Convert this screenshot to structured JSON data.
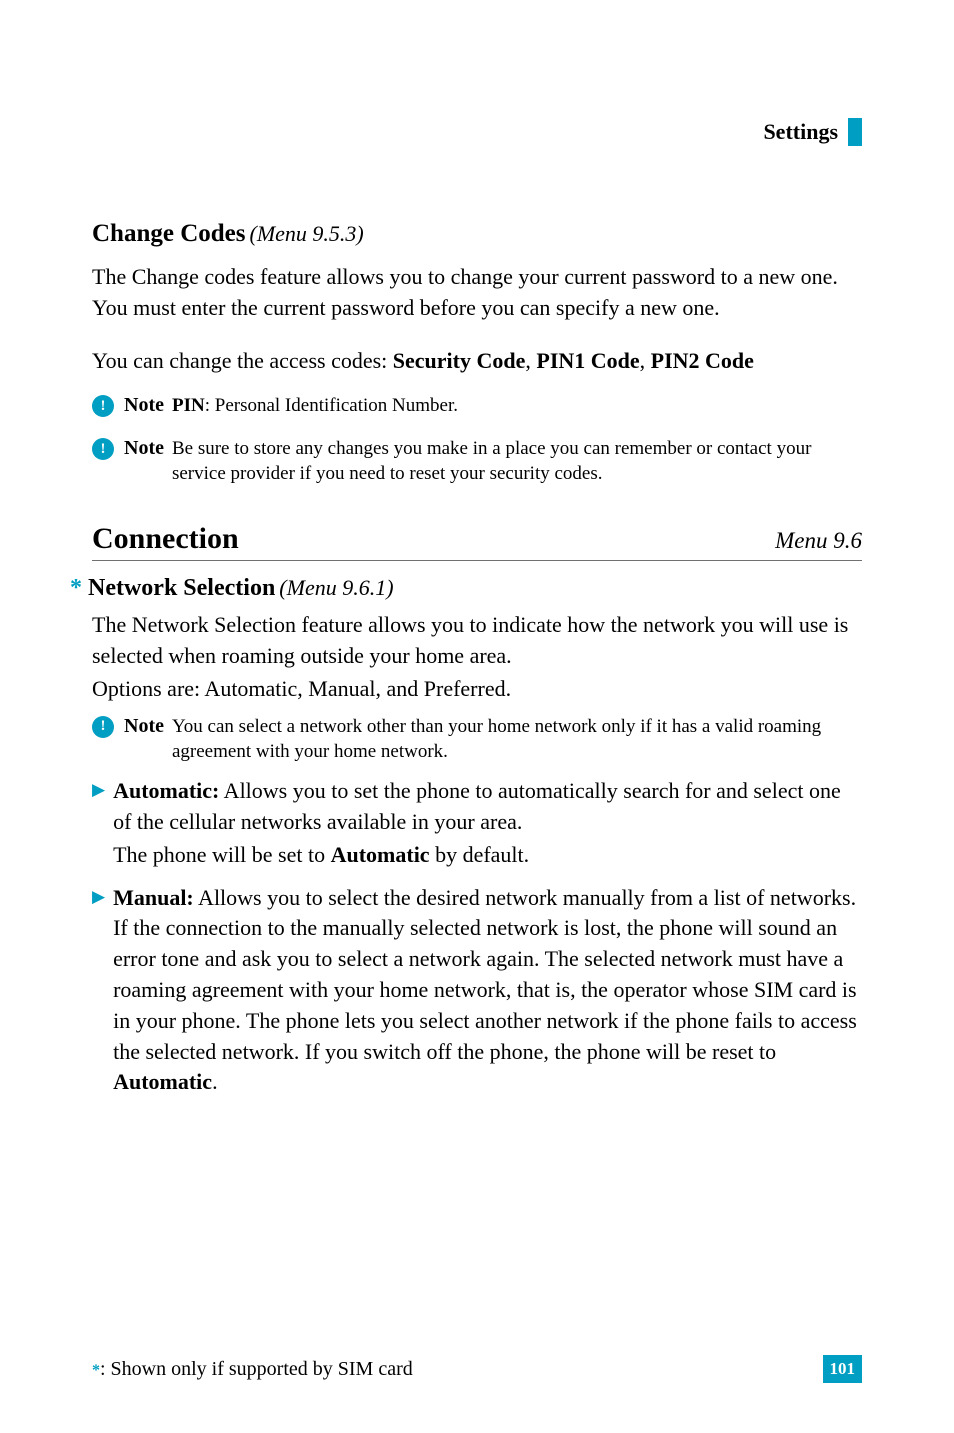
{
  "header": {
    "title": "Settings"
  },
  "changeCodes": {
    "title": "Change Codes",
    "menuRef": "(Menu 9.5.3)",
    "para1": "The Change codes feature allows you to change your current password to a new one. You must enter the current password before you can specify a new one.",
    "para2_pre": "You can change the access codes: ",
    "code1": "Security Code",
    "code2": "PIN1 Code",
    "code3": "PIN2 Code",
    "note1_label": "Note",
    "note1_bold": "PIN",
    "note1_text": ": Personal Identification Number.",
    "note2_label": "Note",
    "note2_text": "Be sure to store any changes you make in a place you can remember or contact your service provider if you need to reset your security codes."
  },
  "connection": {
    "title": "Connection",
    "menuRef": "Menu 9.6"
  },
  "networkSelection": {
    "title": "Network Selection",
    "menuRef": "(Menu 9.6.1)",
    "para1": "The Network Selection feature allows you to indicate how the network you will use is selected when roaming outside your home area.",
    "para2": "Options are: Automatic, Manual, and Preferred.",
    "note_label": "Note",
    "note_text": "You can select a network other than your home network only if it has a valid roaming agreement with your home network.",
    "automatic_label": "Automatic:",
    "automatic_text1": " Allows you to set the phone to automatically search for and select one of the cellular networks available in your area.",
    "automatic_text2_pre": "The phone will be set to ",
    "automatic_text2_bold": "Automatic",
    "automatic_text2_post": " by default.",
    "manual_label": "Manual:",
    "manual_text_pre": " Allows you to select the desired network manually from a list of networks. If the connection to the manually selected network is lost, the phone will sound an error tone and ask you to select a network again. The selected network must have a roaming agreement with your home network, that is, the operator whose SIM card is in your phone. The phone lets you select another network if the phone fails to access the selected network. If you switch off the phone, the phone will be reset to ",
    "manual_bold": "Automatic",
    "manual_post": "."
  },
  "footer": {
    "text": ": Shown only if supported by SIM card",
    "page": "101"
  }
}
